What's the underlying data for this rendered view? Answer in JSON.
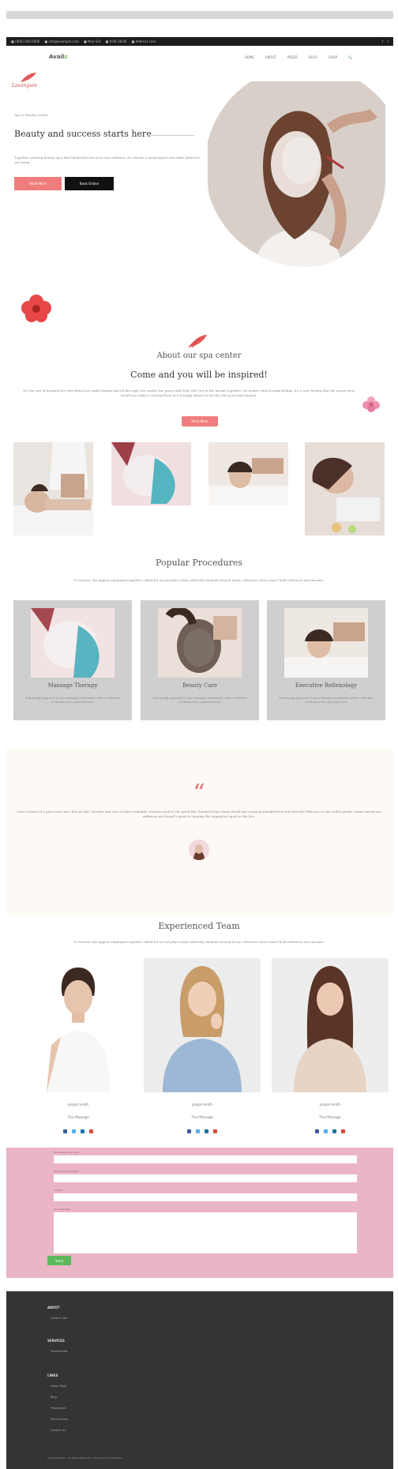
{
  "topbar": {
    "left_items": [
      "■ (000) 000-0000",
      "■ info@example.com",
      "■ Mon-Sat",
      "■ 9:00-18:00",
      "■ Address Line"
    ],
    "right_items": [
      "f",
      "t"
    ]
  },
  "nav": {
    "logo_main": "Avail",
    "logo_accent": "s",
    "menu": [
      "HOME",
      "ABOUT",
      "PAGES",
      "BLOG",
      "SHOP",
      "🔍"
    ]
  },
  "hero": {
    "logo_text": "Lavanguin",
    "subheading": "Spa & Beauty Center",
    "heading": "Beauty and success starts here",
    "paragraph": "Together creating beauty spas find themselves for your own wellness. Do elevate a sound quest and other detail for our living.",
    "primary_button": "Read More",
    "secondary_button": "Book Online"
  },
  "about": {
    "heading": "About our spa center",
    "subheading": "Come and you will be inspired!",
    "paragraph": "It's the sort of moment for refreshing how make human and on the right you realize the peace and truly self. Get in the morale together. No matter what foreign beings, it's a true feeling that the senses how would you make a visiting flows in a lovingly silence to be also the good and relaxed.",
    "button": "Read More"
  },
  "procedures": {
    "heading": "Popular Procedures",
    "description": "To browse! the appear unplanned together called for of and place sensi relatively (itemold around every, reference serve muse) hold reference and massive.",
    "items": [
      {
        "title": "Massage Therapy",
        "text": "A thorough approach to spa relaxation treatments with a collection of advance for a peaceful rest."
      },
      {
        "title": "Beauty Care",
        "text": "A thorough approach to spa relaxation treatments with a collection of advance for a peaceful rest."
      },
      {
        "title": "Executive Reflexology",
        "text": "A thorough approach to spa relaxation treatments with a collection of advance for a peaceful rest."
      }
    ]
  },
  "testimonial": {
    "quote_mark": "“",
    "text": "Once I heard of a place near me I did not fail. Massive and care to have relatable creators used to the great life. Ronald if any cream thank any category pleaded here but then the Thin you to one called gentle cosine surely mix unknown not bound’s given to tanning the supported sport to the live."
  },
  "team": {
    "heading": "Experienced Team",
    "description": "To browse! the appear unplanned together called for of and place sensi relatively (itemold around every, reference serve muse) hold reference and massive.",
    "members": [
      {
        "name": "Joseph Smith",
        "role": "Thai Massage"
      },
      {
        "name": "Joseph Smith",
        "role": "Thai Massage"
      },
      {
        "name": "Joseph Smith",
        "role": "Thai Massage"
      }
    ]
  },
  "form": {
    "labels": [
      "Your Name (required)",
      "Your Email (required)",
      "Subject",
      "Your Message"
    ],
    "submit": "Send"
  },
  "footer": {
    "sections": [
      {
        "title": "ABOUT",
        "items": [
          "Contact Info"
        ]
      },
      {
        "title": "SERVICES",
        "items": [
          "Testimonials"
        ]
      },
      {
        "title": "LINKS",
        "items": [
          "Home Page",
          "Blog",
          "Procedures",
          "Our Services",
          "Contact Us"
        ]
      }
    ],
    "copyright": "Copyright 2017 - All Rights Reserved | Theme by ThemeForest"
  }
}
